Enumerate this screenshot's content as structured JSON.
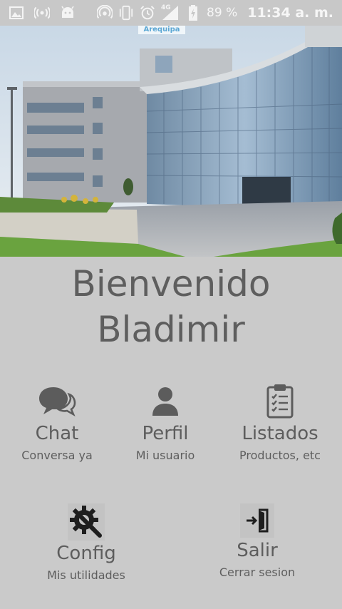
{
  "status_bar": {
    "battery": "89 %",
    "network": "4G",
    "time": "11:34 a. m.",
    "left_icons": [
      "image-icon",
      "wireless-icon",
      "android-icon"
    ],
    "right_icons": [
      "hotspot-icon",
      "vibrate-icon",
      "alarm-icon",
      "signal-icon",
      "battery-charging-icon"
    ]
  },
  "hero": {
    "sign_text": "Arequipa"
  },
  "welcome": {
    "line1": "Bienvenido",
    "line2": "Bladimir"
  },
  "menu": {
    "chat": {
      "label": "Chat",
      "sub": "Conversa ya",
      "icon": "chat-bubbles-icon"
    },
    "perfil": {
      "label": "Perfil",
      "sub": "Mi usuario",
      "icon": "user-icon"
    },
    "listados": {
      "label": "Listados",
      "sub": "Productos, etc",
      "icon": "clipboard-list-icon"
    },
    "config": {
      "label": "Config",
      "sub": "Mis utilidades",
      "icon": "settings-tools-icon"
    },
    "salir": {
      "label": "Salir",
      "sub": "Cerrar sesion",
      "icon": "logout-door-icon"
    }
  },
  "colors": {
    "background": "#cacaca",
    "text": "#5e5e5e",
    "icon": "#5c5c5c"
  }
}
